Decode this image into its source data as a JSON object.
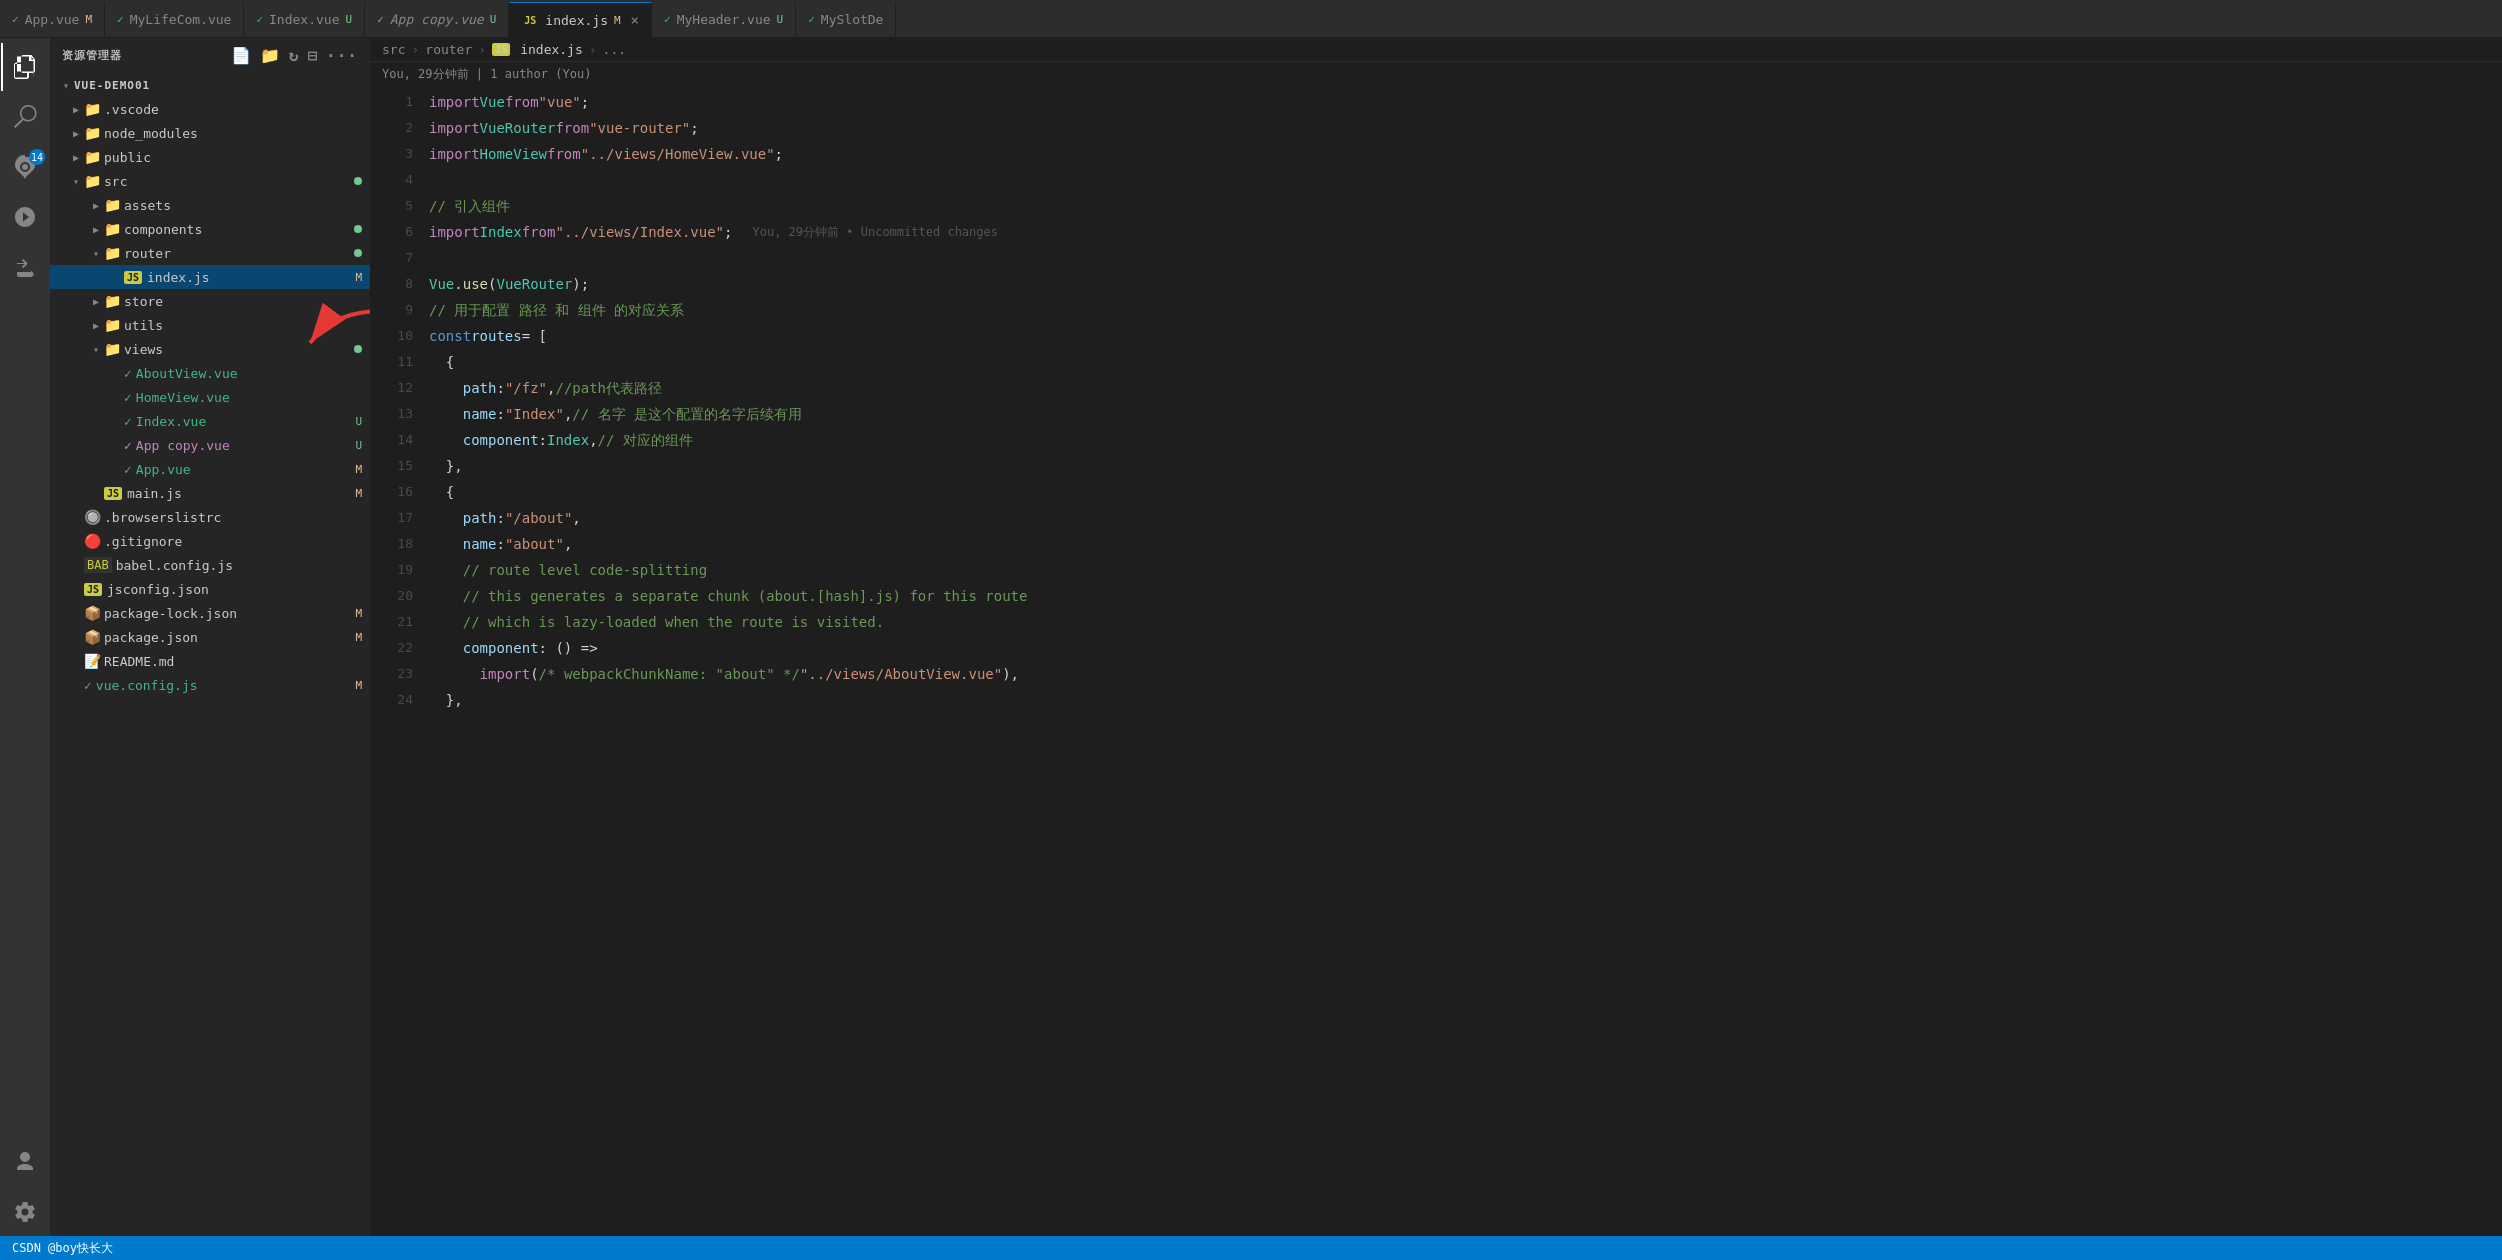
{
  "app": {
    "title": "资源管理器",
    "project": "VUE-DEMO01"
  },
  "tabs": [
    {
      "id": "app-vue",
      "label": "App.vue",
      "icon": "vue",
      "badge": "M",
      "active": false
    },
    {
      "id": "mylifecom-vue",
      "label": "MyLifeCom.vue",
      "icon": "vue",
      "badge": "",
      "active": false
    },
    {
      "id": "index-vue",
      "label": "Index.vue",
      "icon": "vue",
      "badge": "U",
      "active": false
    },
    {
      "id": "app-copy-vue",
      "label": "App copy.vue",
      "icon": "vue",
      "badge": "U",
      "active": false
    },
    {
      "id": "index-js",
      "label": "index.js",
      "icon": "js",
      "badge": "M",
      "active": true,
      "closeable": true
    },
    {
      "id": "myheader-vue",
      "label": "MyHeader.vue",
      "icon": "vue",
      "badge": "U",
      "active": false
    },
    {
      "id": "myslotde",
      "label": "MySlotDe",
      "icon": "vue",
      "badge": "",
      "active": false
    }
  ],
  "breadcrumb": {
    "parts": [
      "src",
      "router",
      "JS index.js",
      "..."
    ]
  },
  "git_info": {
    "text": "You, 29分钟前 | 1 author (You)"
  },
  "sidebar": {
    "header": "资源管理器",
    "project": "VUE-DEMO01",
    "items": [
      {
        "id": "vscode",
        "name": ".vscode",
        "type": "folder",
        "indent": 1,
        "collapsed": true,
        "color": "blue"
      },
      {
        "id": "node_modules",
        "name": "node_modules",
        "type": "folder",
        "indent": 1,
        "collapsed": true,
        "color": "orange"
      },
      {
        "id": "public",
        "name": "public",
        "type": "folder",
        "indent": 1,
        "collapsed": true,
        "color": "orange"
      },
      {
        "id": "src",
        "name": "src",
        "type": "folder",
        "indent": 1,
        "collapsed": false,
        "color": "orange",
        "dot": true
      },
      {
        "id": "assets",
        "name": "assets",
        "type": "folder",
        "indent": 2,
        "collapsed": true,
        "color": "orange"
      },
      {
        "id": "components",
        "name": "components",
        "type": "folder",
        "indent": 2,
        "collapsed": true,
        "color": "orange",
        "dot": true
      },
      {
        "id": "router",
        "name": "router",
        "type": "folder",
        "indent": 2,
        "collapsed": false,
        "color": "orange",
        "dot": true
      },
      {
        "id": "index-js",
        "name": "index.js",
        "type": "js",
        "indent": 3,
        "badge": "M",
        "selected": true
      },
      {
        "id": "store",
        "name": "store",
        "type": "folder",
        "indent": 2,
        "collapsed": true,
        "color": "orange"
      },
      {
        "id": "utils",
        "name": "utils",
        "type": "folder",
        "indent": 2,
        "collapsed": true,
        "color": "orange"
      },
      {
        "id": "views",
        "name": "views",
        "type": "folder",
        "indent": 2,
        "collapsed": false,
        "color": "orange",
        "dot": true
      },
      {
        "id": "aboutview",
        "name": "AboutView.vue",
        "type": "vue",
        "indent": 3
      },
      {
        "id": "homeview",
        "name": "HomeView.vue",
        "type": "vue",
        "indent": 3
      },
      {
        "id": "index-vue",
        "name": "Index.vue",
        "type": "vue",
        "indent": 3,
        "badge": "U"
      },
      {
        "id": "app-copy",
        "name": "App copy.vue",
        "type": "vue",
        "indent": 3,
        "badge": "U"
      },
      {
        "id": "app-vue",
        "name": "App.vue",
        "type": "vue",
        "indent": 3,
        "badge": "M"
      },
      {
        "id": "main-js",
        "name": "main.js",
        "type": "js",
        "indent": 2,
        "badge": "M"
      },
      {
        "id": "browserslistrc",
        "name": ".browserslistrc",
        "type": "config",
        "indent": 1
      },
      {
        "id": "gitignore",
        "name": ".gitignore",
        "type": "git",
        "indent": 1
      },
      {
        "id": "babel-config",
        "name": "babel.config.js",
        "type": "babel",
        "indent": 1
      },
      {
        "id": "jsconfig",
        "name": "jsconfig.json",
        "type": "js",
        "indent": 1
      },
      {
        "id": "package-lock",
        "name": "package-lock.json",
        "type": "npm-lock",
        "indent": 1,
        "badge": "M"
      },
      {
        "id": "package-json",
        "name": "package.json",
        "type": "npm",
        "indent": 1,
        "badge": "M"
      },
      {
        "id": "readme",
        "name": "README.md",
        "type": "md",
        "indent": 1
      },
      {
        "id": "vue-config",
        "name": "vue.config.js",
        "type": "vue-config",
        "indent": 1,
        "badge": "M"
      }
    ]
  },
  "code": {
    "lines": [
      {
        "num": 1,
        "content": "import Vue from \"vue\";"
      },
      {
        "num": 2,
        "content": "import VueRouter from \"vue-router\";"
      },
      {
        "num": 3,
        "content": "import HomeView from \"../views/HomeView.vue\";"
      },
      {
        "num": 4,
        "content": ""
      },
      {
        "num": 5,
        "content": "// 引入组件"
      },
      {
        "num": 6,
        "content": "import Index from \"../views/Index.vue\";"
      },
      {
        "num": 7,
        "content": ""
      },
      {
        "num": 8,
        "content": "Vue.use(VueRouter);"
      },
      {
        "num": 9,
        "content": "// 用于配置 路径 和 组件 的对应关系"
      },
      {
        "num": 10,
        "content": "const routes = ["
      },
      {
        "num": 11,
        "content": "  {"
      },
      {
        "num": 12,
        "content": "    path: \"/fz\",  //path代表路径"
      },
      {
        "num": 13,
        "content": "    name: \"Index\", // 名字 是这个配置的名字后续有用"
      },
      {
        "num": 14,
        "content": "    component: Index,  // 对应的组件"
      },
      {
        "num": 15,
        "content": "  },"
      },
      {
        "num": 16,
        "content": "  {"
      },
      {
        "num": 17,
        "content": "    path: \"/about\","
      },
      {
        "num": 18,
        "content": "    name: \"about\","
      },
      {
        "num": 19,
        "content": "    // route level code-splitting"
      },
      {
        "num": 20,
        "content": "    // this generates a separate chunk (about.[hash].js) for this route"
      },
      {
        "num": 21,
        "content": "    // which is lazy-loaded when the route is visited."
      },
      {
        "num": 22,
        "content": "    component: () =>"
      },
      {
        "num": 23,
        "content": "      import(/* webpackChunkName: \"about\" */ \"../views/AboutView.vue\"),"
      },
      {
        "num": 24,
        "content": "  },"
      }
    ],
    "git_blame": {
      "line": 6,
      "text": "You, 29分钟前 • Uncommitted changes"
    }
  },
  "status_bar": {
    "text": "CSDN @boy快长大"
  },
  "activity": {
    "icons": [
      {
        "id": "explorer",
        "symbol": "⊞",
        "active": true,
        "label": "Explorer"
      },
      {
        "id": "search",
        "symbol": "🔍",
        "active": false,
        "label": "Search"
      },
      {
        "id": "git",
        "symbol": "⎇",
        "active": false,
        "label": "Source Control",
        "badge": "14"
      },
      {
        "id": "run",
        "symbol": "▶",
        "active": false,
        "label": "Run"
      },
      {
        "id": "extensions",
        "symbol": "⊞",
        "active": false,
        "label": "Extensions"
      },
      {
        "id": "accounts",
        "symbol": "◉",
        "active": false,
        "label": "Accounts"
      },
      {
        "id": "settings",
        "symbol": "⚙",
        "active": false,
        "label": "Settings"
      }
    ]
  }
}
